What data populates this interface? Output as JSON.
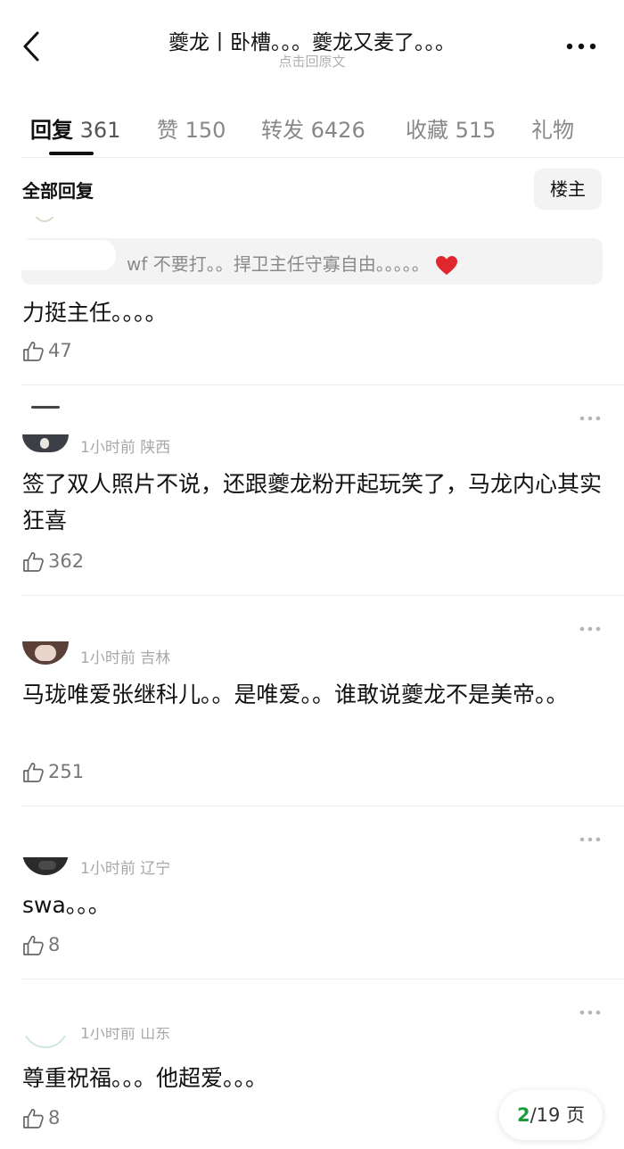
{
  "header": {
    "title": "夔龙丨卧槽。。。夔龙又麦了。。。",
    "subtitle": "点击回原文"
  },
  "tabs": [
    {
      "name": "回复",
      "count": "361"
    },
    {
      "name": "赞",
      "count": "150"
    },
    {
      "name": "转发",
      "count": "6426"
    },
    {
      "name": "收藏",
      "count": "515"
    },
    {
      "name": "礼物",
      "count": ""
    }
  ],
  "filter": {
    "label": "全部回复",
    "owner_button": "楼主"
  },
  "comments": [
    {
      "quote": "wf 不要打。。捍卫主任守寡自由。。。。。",
      "text": "力挺主任。。。。",
      "likes": "47"
    },
    {
      "time": "1小时前",
      "location": "陕西",
      "text": "签了双人照片不说，还跟夔龙粉开起玩笑了，马龙内心其实狂喜",
      "likes": "362"
    },
    {
      "time": "1小时前",
      "location": "吉林",
      "text": "马珑唯爱张继科儿。。是唯爱。。谁敢说夔龙不是美帝。。",
      "likes": "251"
    },
    {
      "time": "1小时前",
      "location": "辽宁",
      "text": "swa。。。",
      "likes": "8"
    },
    {
      "time_partial": "1小时前 山东",
      "text": "尊重祝福。。。他超爱。。。",
      "likes": "8"
    }
  ],
  "pager": {
    "current": "2",
    "total": "/19 页"
  },
  "colors": {
    "accent": "#1a9b3c",
    "text": "#111111",
    "muted": "#a8a8a8"
  }
}
